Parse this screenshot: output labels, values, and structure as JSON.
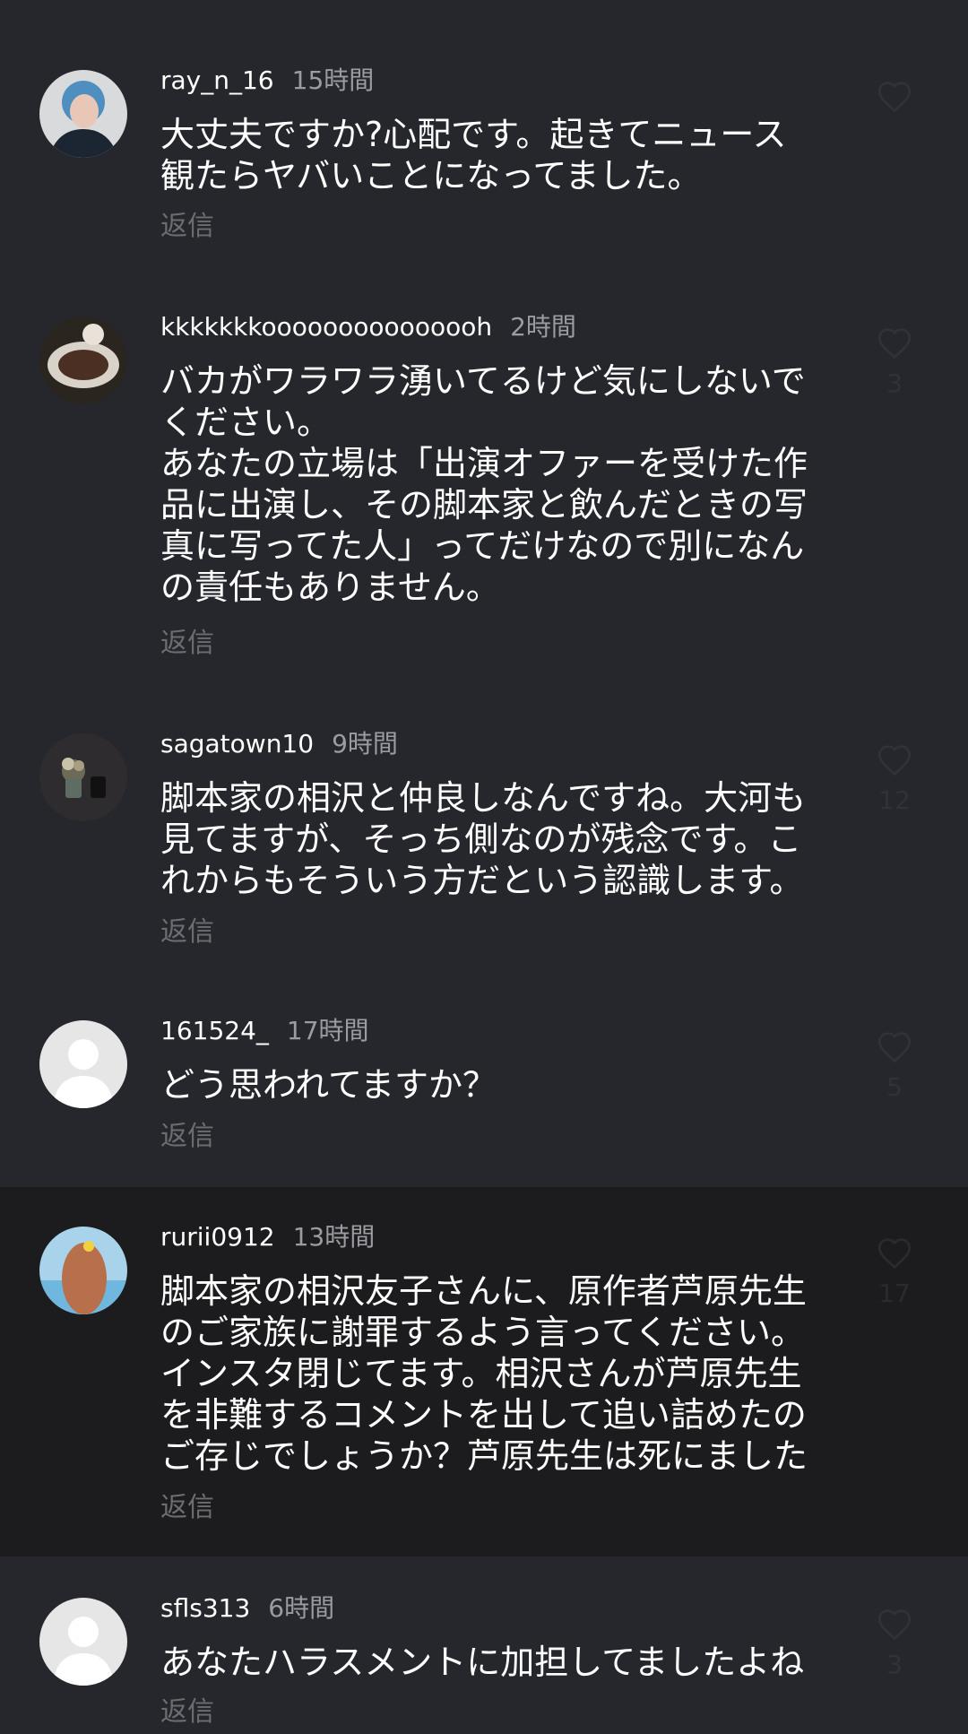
{
  "comments": [
    {
      "username": "ray_n_16",
      "time": "15時間",
      "text": "大丈夫ですか?心配です。起きてニュース\n観たらヤバいことになってました。",
      "reply": "返信",
      "likes": ""
    },
    {
      "username": "kkkkkkkooooooooooooooh",
      "time": "2時間",
      "text": "バカがワラワラ湧いてるけど気にしないで\nください。\nあなたの立場は「出演オファーを受けた作\n品に出演し、その脚本家と飲んだときの写\n真に写ってた人」ってだけなので別になん\nの責任もありません。",
      "reply": "返信",
      "likes": "3"
    },
    {
      "username": "sagatown10",
      "time": "9時間",
      "text": "脚本家の相沢と仲良しなんですね。大河も\n見てますが、そっち側なのが残念です。こ\nれからもそういう方だという認識します。",
      "reply": "返信",
      "likes": "12"
    },
    {
      "username": "161524_",
      "time": "17時間",
      "text": "どう思われてますか？",
      "reply": "返信",
      "likes": "5"
    },
    {
      "username": "rurii0912",
      "time": "13時間",
      "text": "脚本家の相沢友子さんに、原作者芦原先生\nのご家族に謝罪するよう言ってください。\nインスタ閉じてます。相沢さんが芦原先生\nを非難するコメントを出して追い詰めたの\nご存じでしょうか？芦原先生は死にました",
      "reply": "返信",
      "likes": "17"
    },
    {
      "username": "sfls313",
      "time": "6時間",
      "text": "あなたハラスメントに加担してましたよね",
      "reply": "返信",
      "likes": "3"
    }
  ]
}
